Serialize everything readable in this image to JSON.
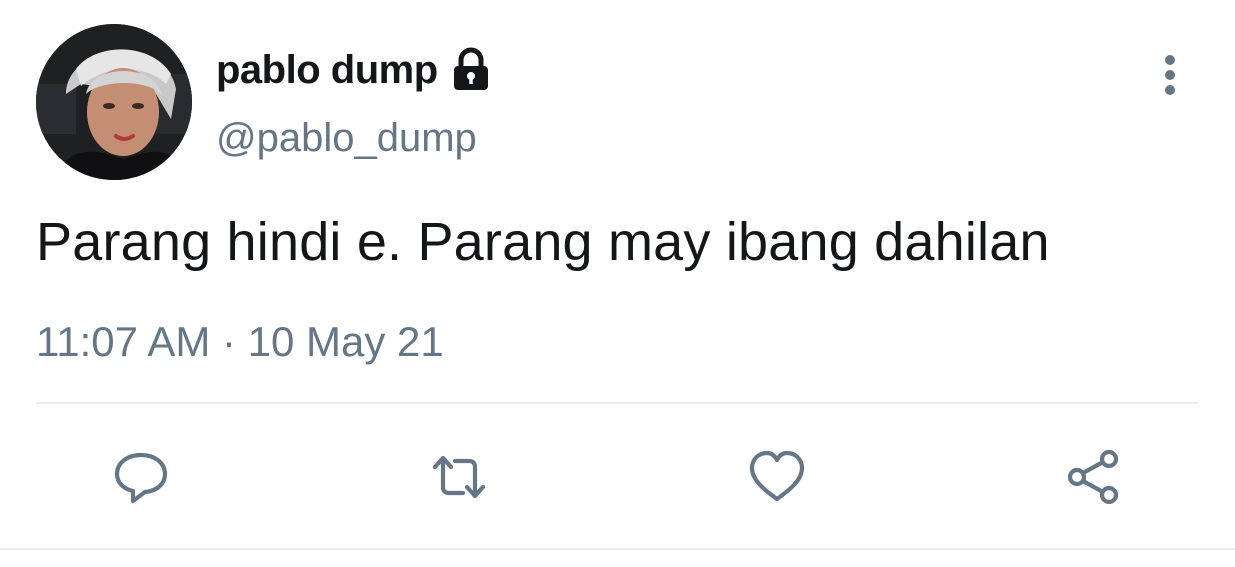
{
  "tweet": {
    "author": {
      "display_name": "pablo dump",
      "handle": "@pablo_dump",
      "protected_icon": "lock-icon",
      "avatar": "profile-photo"
    },
    "text": "Parang hindi e. Parang may ibang dahilan",
    "timestamp": "11:07 AM · 10 May 21",
    "more_icon": "vertical-dots-icon",
    "actions": [
      {
        "name": "reply",
        "icon": "speech-bubble-icon"
      },
      {
        "name": "retweet",
        "icon": "retweet-icon"
      },
      {
        "name": "like",
        "icon": "heart-icon"
      },
      {
        "name": "share",
        "icon": "share-icon"
      }
    ]
  },
  "colors": {
    "text_primary": "#14171a",
    "text_secondary": "#657786",
    "divider": "#e6ecf0"
  }
}
